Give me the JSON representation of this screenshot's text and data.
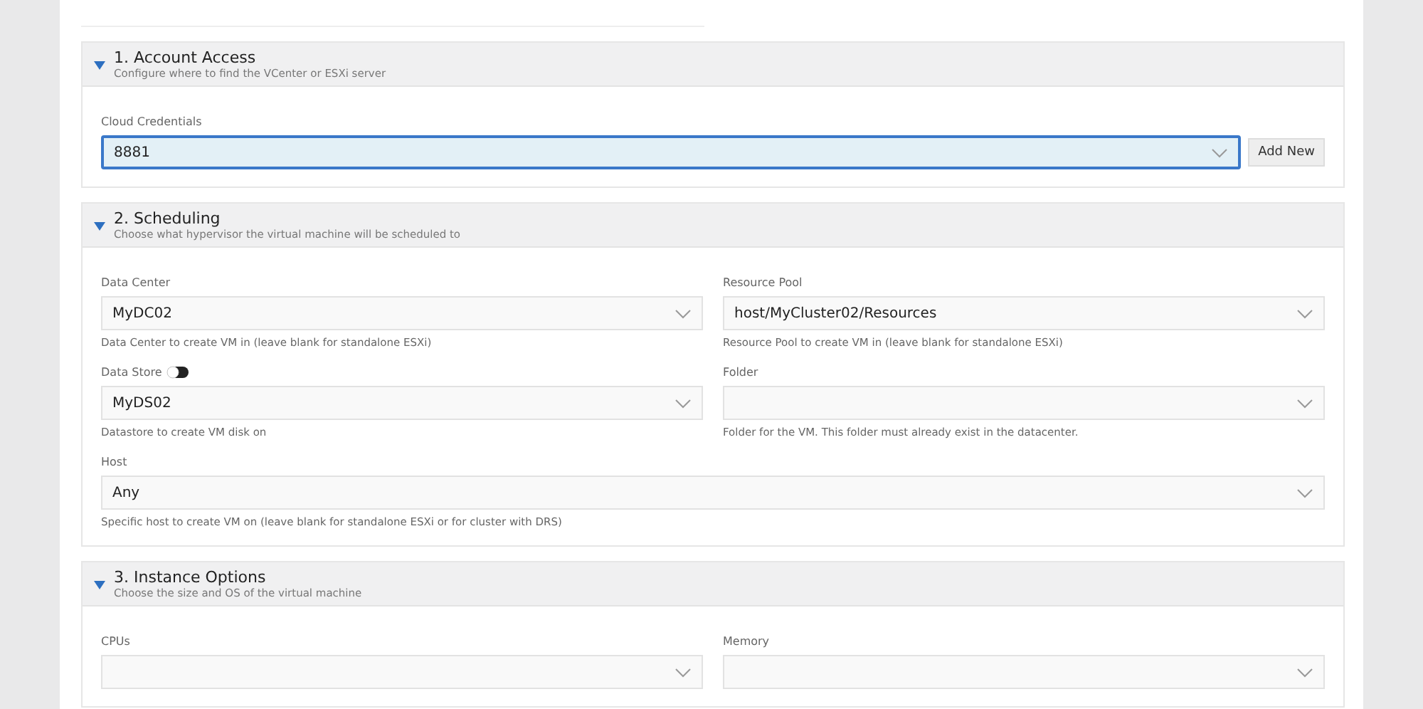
{
  "sections": [
    {
      "title": "1. Account Access",
      "subtitle": "Configure where to find the VCenter or ESXi server",
      "expanded": true,
      "rows": [
        [
          {
            "kind": "select",
            "label": "Cloud Credentials",
            "value": "8881",
            "focused": true,
            "button": "Add New"
          }
        ]
      ]
    },
    {
      "title": "2. Scheduling",
      "subtitle": "Choose what hypervisor the virtual machine will be scheduled to",
      "expanded": true,
      "rows": [
        [
          {
            "kind": "select",
            "label": "Data Center",
            "value": "MyDC02",
            "hint": "Data Center to create VM in (leave blank for standalone ESXi)",
            "focused": false
          },
          {
            "kind": "select",
            "label": "Resource Pool",
            "value": "host/MyCluster02/Resources",
            "hint": "Resource Pool to create VM in (leave blank for standalone ESXi)",
            "focused": false
          }
        ],
        [
          {
            "kind": "select",
            "label": "Data Store",
            "toggle_on": true,
            "value": "MyDS02",
            "hint": "Datastore to create VM disk on",
            "focused": false
          },
          {
            "kind": "select",
            "label": "Folder",
            "hint": "Folder for the VM. This folder must already exist in the datacenter.",
            "focused": false
          }
        ],
        [
          {
            "kind": "select",
            "label": "Host",
            "value": "Any",
            "hint": "Specific host to create VM on (leave blank for standalone ESXi or for cluster with DRS)",
            "focused": false
          }
        ]
      ]
    },
    {
      "title": "3. Instance Options",
      "subtitle": "Choose the size and OS of the virtual machine",
      "expanded": true,
      "rows": [
        [
          {
            "kind": "select",
            "label": "CPUs",
            "focused": false
          },
          {
            "kind": "select",
            "label": "Memory",
            "focused": false
          }
        ]
      ]
    }
  ]
}
